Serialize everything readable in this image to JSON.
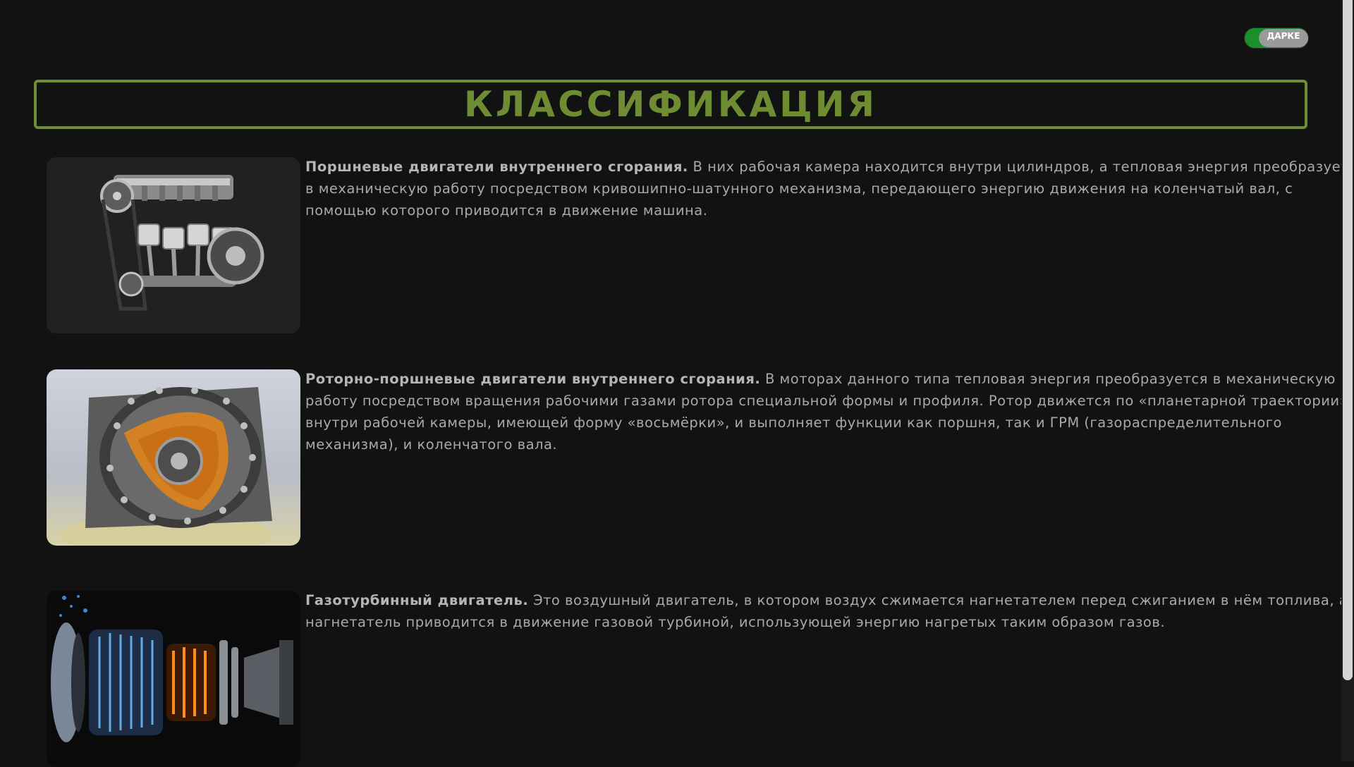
{
  "theme_toggle": {
    "label": "ДАРКЕ"
  },
  "page": {
    "title": "КЛАССИФИКАЦИЯ"
  },
  "items": [
    {
      "name": "Поршневые двигатели внутреннего сгорания.",
      "text": " В них рабочая камера находится внутри цилиндров, а тепловая энергия преобразуется в механическую работу посредством кривошипно-шатунного механизма, передающего энергию движения на коленчатый вал, с помощью которого приводится в движение машина.",
      "image": "piston-engine-image"
    },
    {
      "name": "Роторно-поршневые двигатели внутреннего сгорания.",
      "text": " В моторах данного типа тепловая энергия преобразуется в механическую работу посредством вращения рабочими газами ротора специальной формы и профиля. Ротор движется по «планетарной траектории» внутри рабочей камеры, имеющей форму «восьмёрки», и выполняет функции как поршня, так и ГРМ (газораспределительного механизма), и коленчатого вала.",
      "image": "rotary-engine-image"
    },
    {
      "name": "Газотурбинный двигатель.",
      "text": " Это воздушный двигатель, в котором воздух сжимается нагнетателем перед сжиганием в нём топлива, а нагнетатель приводится в движение газовой турбиной, использующей энергию нагретых таким образом газов.",
      "image": "gas-turbine-image"
    }
  ]
}
